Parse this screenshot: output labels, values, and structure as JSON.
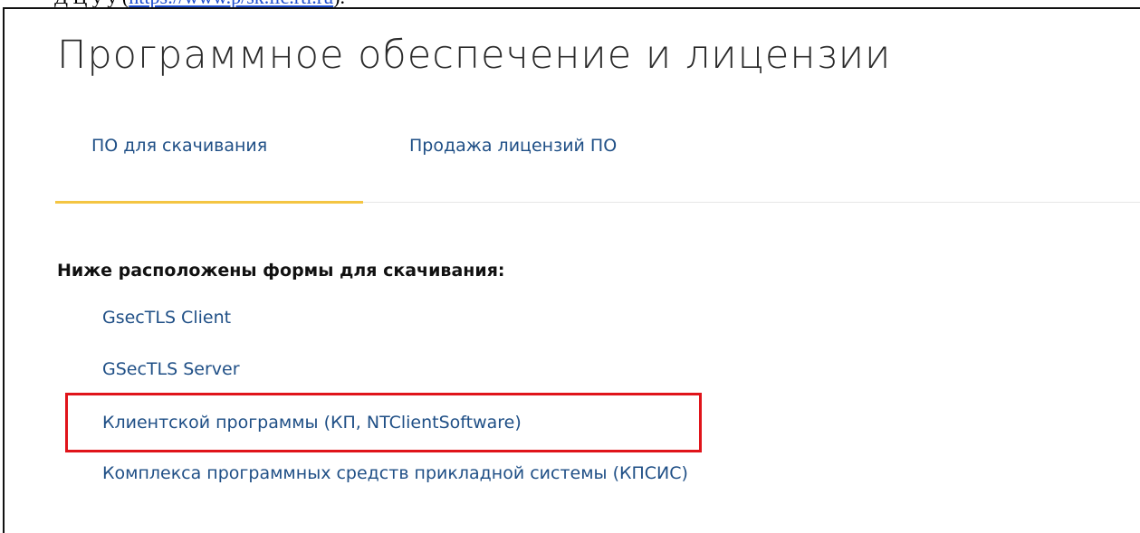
{
  "doc_line": {
    "prefix": "Д                   Ц                                        у   у  (",
    "link": "https://www.p/sk.lic.rtl.ru",
    "suffix": ")."
  },
  "page": {
    "title": "Программное обеспечение и лицензии"
  },
  "tabs": [
    {
      "label": "ПО для скачивания",
      "active": true
    },
    {
      "label": "Продажа лицензий ПО",
      "active": false
    }
  ],
  "colors": {
    "accent_underline": "#f4c542",
    "link": "#1f4f86",
    "highlight": "#e0141a"
  },
  "downloads": {
    "heading": "Ниже расположены формы для скачивания:",
    "items": [
      {
        "label": "GsecTLS Client"
      },
      {
        "label": "GSecTLS Server"
      },
      {
        "label": "Клиентской программы (КП, NTClientSoftware)",
        "highlighted": true
      },
      {
        "label": "Комплекса программных средств прикладной системы (КПСИС)"
      }
    ]
  }
}
